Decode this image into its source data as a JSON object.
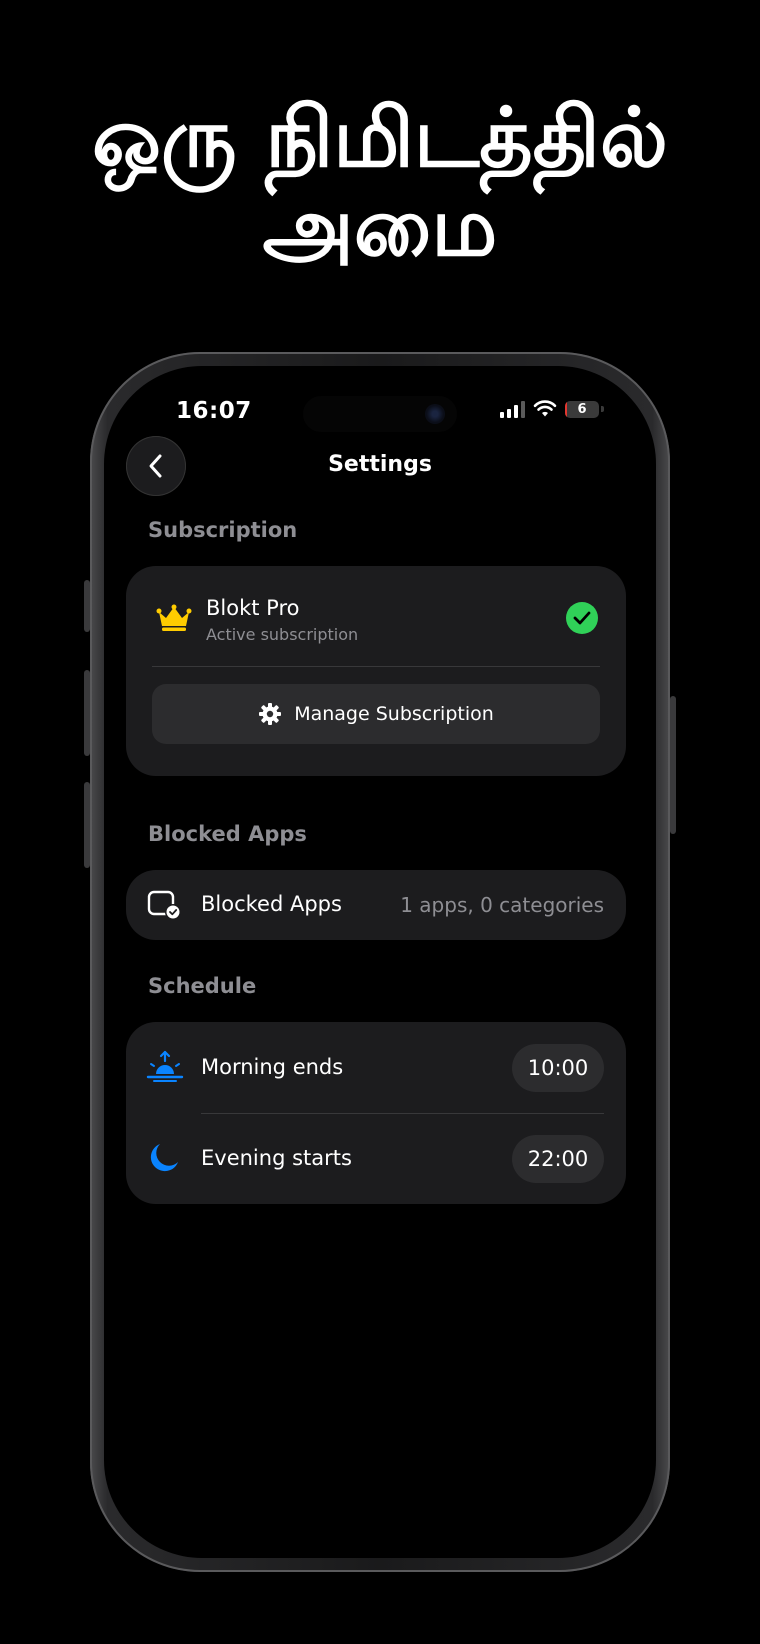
{
  "headline": {
    "line1": "ஒரு நிமிடத்தில்",
    "line2": "அமை"
  },
  "status_bar": {
    "time": "16:07",
    "battery_level": "6",
    "battery_fraction": 0.06
  },
  "nav": {
    "title": "Settings",
    "back_icon": "chevron-left-icon"
  },
  "subscription": {
    "section_label": "Subscription",
    "plan_name": "Blokt Pro",
    "plan_status": "Active subscription",
    "plan_icon": "crown-icon",
    "status_icon": "checkmark-circle-icon",
    "manage_label": "Manage Subscription",
    "manage_icon": "gear-icon"
  },
  "blocked_apps": {
    "section_label": "Blocked Apps",
    "row_label": "Blocked Apps",
    "row_value": "1 apps, 0 categories",
    "row_icon": "app-check-icon"
  },
  "schedule": {
    "section_label": "Schedule",
    "items": [
      {
        "label": "Morning ends",
        "time": "10:00",
        "icon": "sunrise-icon"
      },
      {
        "label": "Evening starts",
        "time": "22:00",
        "icon": "moon-icon"
      }
    ]
  },
  "colors": {
    "background": "#000000",
    "card": "#1c1c1e",
    "pill": "#2c2c2e",
    "secondary_text": "#8e8e93",
    "accent_blue": "#0a84ff",
    "crown_yellow": "#ffcc00",
    "check_green": "#30d158",
    "battery_red": "#e5362f"
  }
}
